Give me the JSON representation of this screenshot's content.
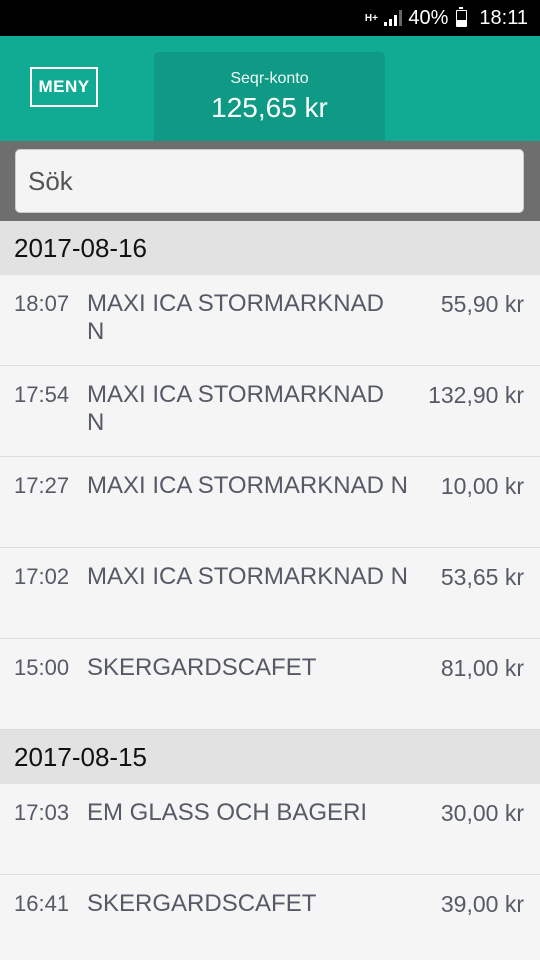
{
  "status_bar": {
    "network": "H+",
    "battery": "40%",
    "time": "18:11"
  },
  "header": {
    "menu_label": "MENY",
    "account_label": "Seqr-konto",
    "account_balance": "125,65 kr"
  },
  "search": {
    "placeholder": "Sök"
  },
  "groups": [
    {
      "date": "2017-08-16",
      "transactions": [
        {
          "time": "18:07",
          "merchant": "MAXI ICA STORMARKNAD N",
          "amount": "55,90 kr"
        },
        {
          "time": "17:54",
          "merchant": "MAXI ICA STORMARKNAD N",
          "amount": "132,90 kr"
        },
        {
          "time": "17:27",
          "merchant": "MAXI ICA STORMARKNAD N",
          "amount": "10,00 kr"
        },
        {
          "time": "17:02",
          "merchant": "MAXI ICA STORMARKNAD N",
          "amount": "53,65 kr"
        },
        {
          "time": "15:00",
          "merchant": "SKERGARDSCAFET",
          "amount": "81,00 kr"
        }
      ]
    },
    {
      "date": "2017-08-15",
      "transactions": [
        {
          "time": "17:03",
          "merchant": "EM GLASS OCH BAGERI",
          "amount": "30,00 kr"
        },
        {
          "time": "16:41",
          "merchant": "SKERGARDSCAFET",
          "amount": "39,00 kr"
        }
      ]
    }
  ]
}
